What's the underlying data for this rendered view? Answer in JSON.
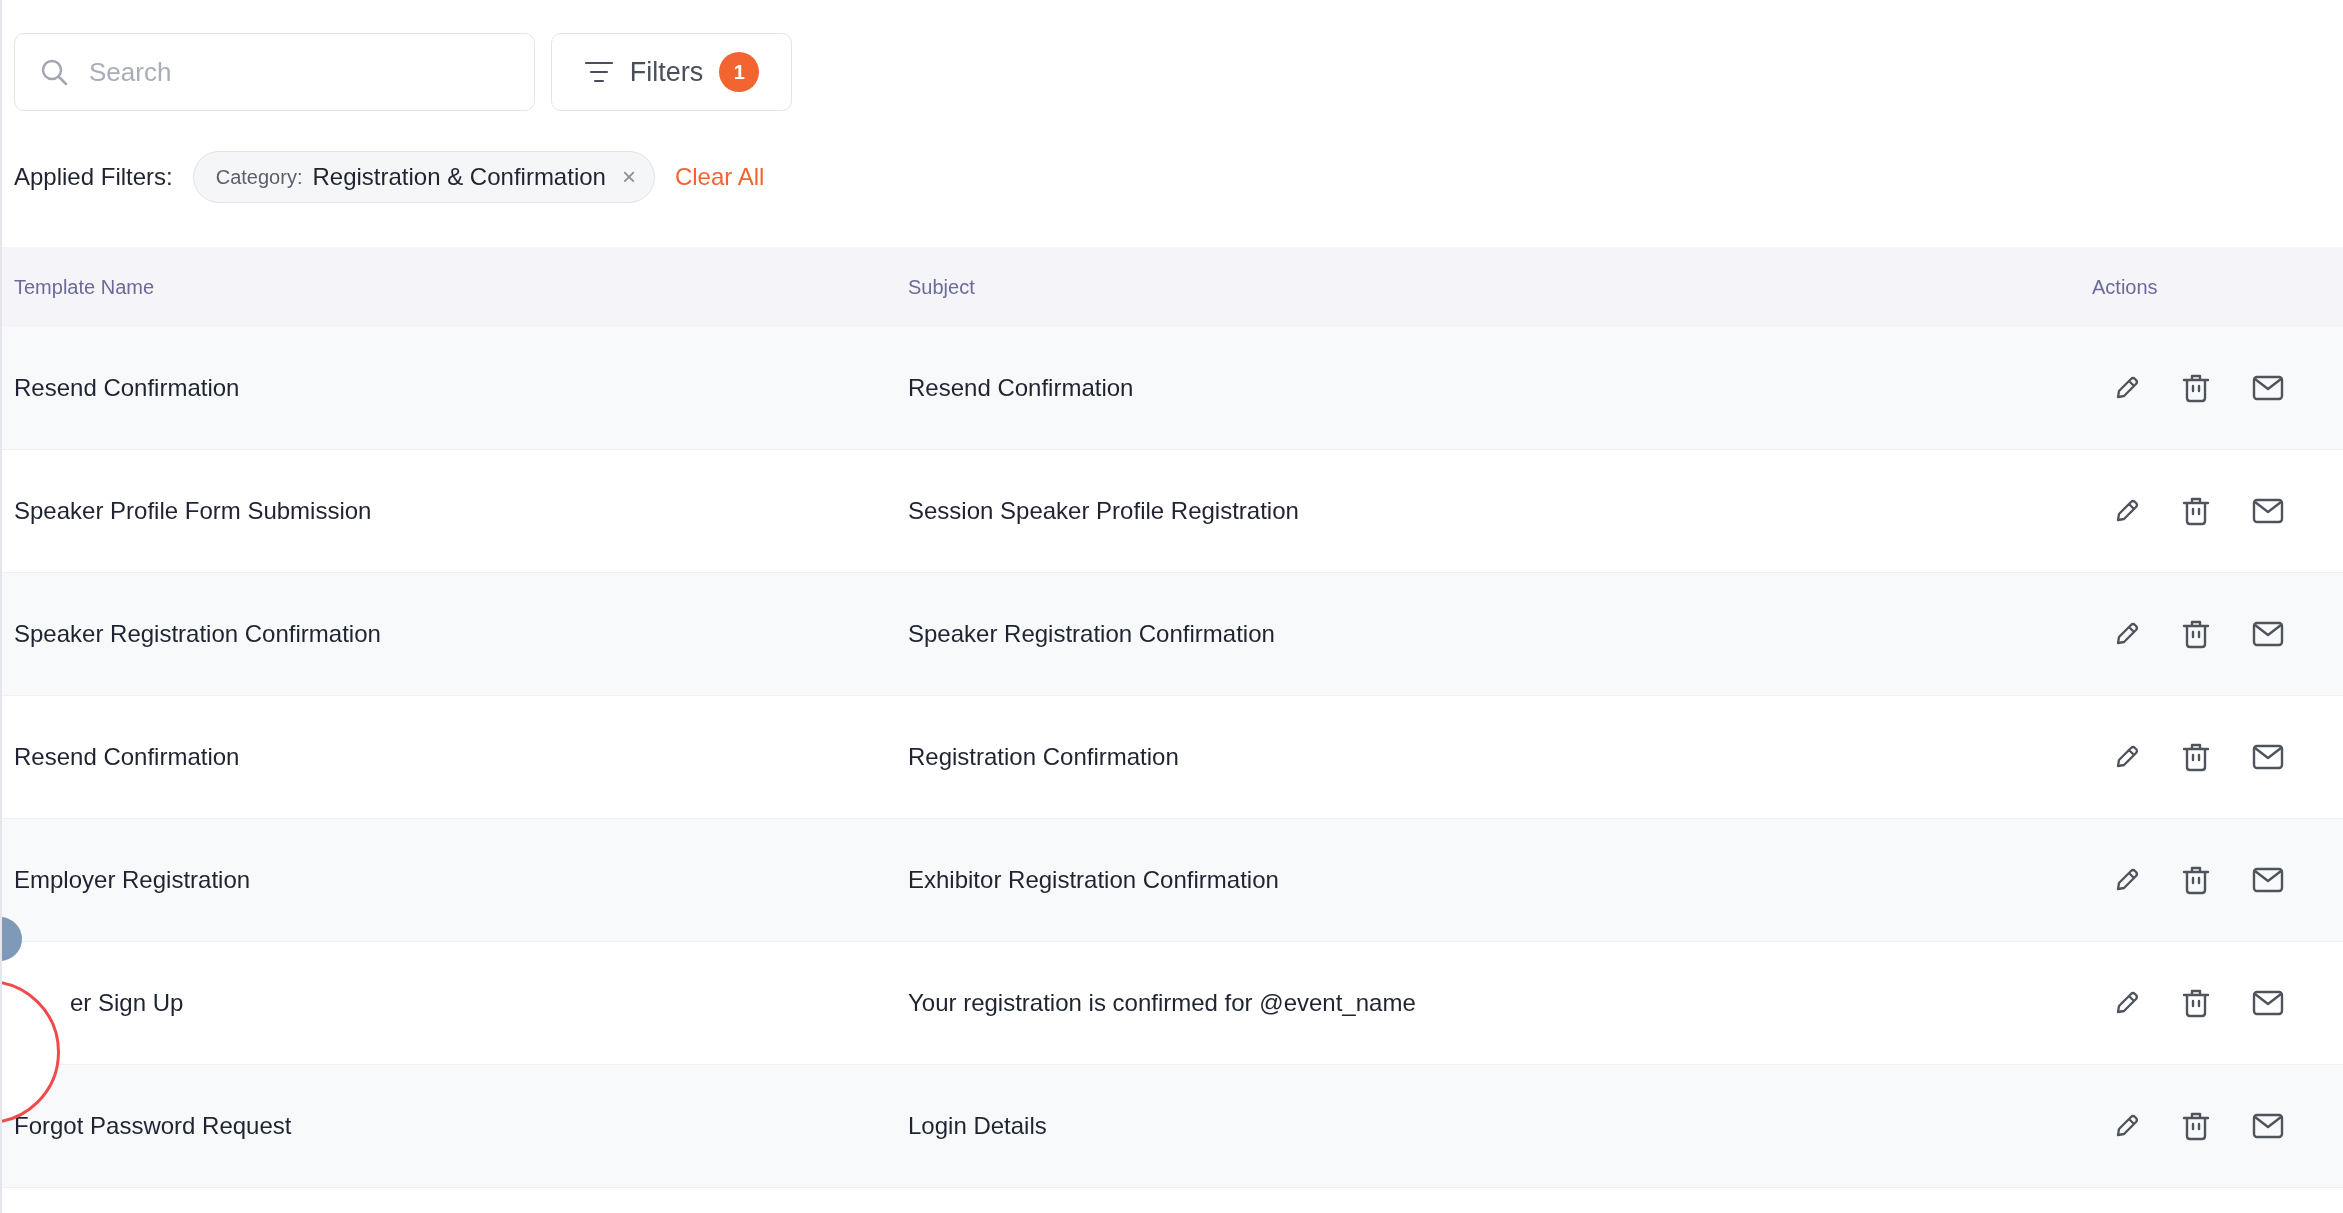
{
  "search": {
    "placeholder": "Search"
  },
  "filters_button": {
    "label": "Filters",
    "count": "1"
  },
  "applied_filters": {
    "label": "Applied Filters:",
    "chips": [
      {
        "key": "Category:",
        "value": "Registration & Confirmation",
        "remove": "×"
      }
    ],
    "clear": "Clear All"
  },
  "table": {
    "columns": [
      "Template Name",
      "Subject",
      "Actions"
    ],
    "rows": [
      {
        "name": "Resend Confirmation",
        "subject": "Resend Confirmation"
      },
      {
        "name": "Speaker Profile Form Submission",
        "subject": "Session Speaker Profile Registration"
      },
      {
        "name": "Speaker Registration Confirmation",
        "subject": "Speaker Registration Confirmation"
      },
      {
        "name": "Resend Confirmation",
        "subject": "Registration Confirmation"
      },
      {
        "name": "Employer Registration",
        "subject": "Exhibitor Registration Confirmation"
      },
      {
        "name": "er Sign Up",
        "subject": "Your registration is confirmed for @event_name",
        "covered": true
      },
      {
        "name": "Forgot Password Request",
        "subject": "Login Details"
      }
    ]
  }
}
